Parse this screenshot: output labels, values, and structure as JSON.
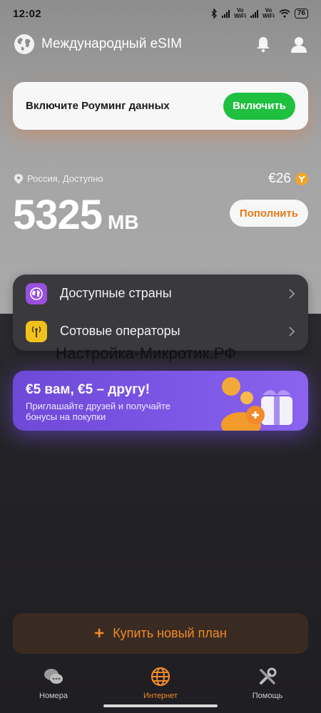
{
  "status_bar": {
    "time": "12:02",
    "vowifi_label": "Vo\nWiFi",
    "battery": "76"
  },
  "header": {
    "title": "Международный eSIM",
    "icons": [
      "globe-icon",
      "bell-icon",
      "user-icon"
    ]
  },
  "roaming": {
    "text": "Включите Роуминг данных",
    "button_label": "Включить"
  },
  "balance": {
    "location": "Россия, Доступно",
    "price": "€26",
    "data_value": "5325",
    "data_unit": "MB",
    "topup_label": "Пополнить"
  },
  "menu": {
    "items": [
      {
        "label": "Доступные страны",
        "icon": "globe-icon"
      },
      {
        "label": "Сотовые операторы",
        "icon": "antenna-icon"
      }
    ]
  },
  "watermark": "Настройка-Микротик.РФ",
  "promo": {
    "title": "€5 вам, €5 – другу!",
    "subtitle": "Приглашайте друзей и получайте бонусы на покупки"
  },
  "buy": {
    "label": "Купить новый план"
  },
  "nav": {
    "items": [
      {
        "label": "Номера",
        "icon": "chat-icon",
        "active": false
      },
      {
        "label": "Интернет",
        "icon": "globe-icon",
        "active": true
      },
      {
        "label": "Помощь",
        "icon": "tools-icon",
        "active": false
      }
    ]
  },
  "colors": {
    "accent_orange": "#f08a2a",
    "green": "#1fbf3f",
    "promo_purple": "#7d57e6"
  }
}
